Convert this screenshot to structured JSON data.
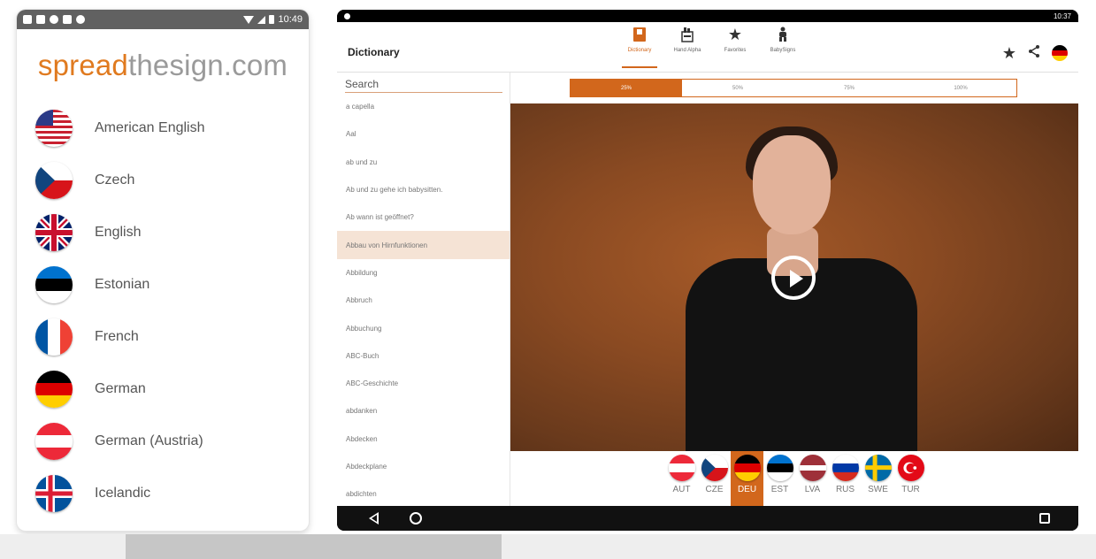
{
  "phone": {
    "status_time": "10:49",
    "logo_part1": "spread",
    "logo_part2": "thesign.com",
    "languages": [
      {
        "label": "American English",
        "flag": "usa"
      },
      {
        "label": "Czech",
        "flag": "cze"
      },
      {
        "label": "English",
        "flag": "gbr"
      },
      {
        "label": "Estonian",
        "flag": "est"
      },
      {
        "label": "French",
        "flag": "fra"
      },
      {
        "label": "German",
        "flag": "deu"
      },
      {
        "label": "German (Austria)",
        "flag": "aut"
      },
      {
        "label": "Icelandic",
        "flag": "isl"
      }
    ]
  },
  "tablet": {
    "status_time": "10:37",
    "title": "Dictionary",
    "nav": [
      {
        "label": "Dictionary",
        "icon": "book-icon",
        "active": true
      },
      {
        "label": "Hand Alpha",
        "icon": "hand-alphabet-icon",
        "active": false
      },
      {
        "label": "Favorites",
        "icon": "star-icon",
        "active": false
      },
      {
        "label": "BabySigns",
        "icon": "baby-icon",
        "active": false
      }
    ],
    "search_placeholder": "Search",
    "words": [
      "a capella",
      "Aal",
      "ab und zu",
      "Ab und zu gehe ich babysitten.",
      "Ab wann ist geöffnet?",
      "Abbau von Hirnfunktionen",
      "Abbildung",
      "Abbruch",
      "Abbuchung",
      "ABC-Buch",
      "ABC-Geschichte",
      "abdanken",
      "Abdecken",
      "Abdeckplane",
      "abdichten"
    ],
    "active_word_index": 5,
    "speed_options": [
      "25%",
      "50%",
      "75%",
      "100%"
    ],
    "active_speed_index": 0,
    "sign_languages": [
      {
        "code": "AUT",
        "flag": "aut"
      },
      {
        "code": "CZE",
        "flag": "cze"
      },
      {
        "code": "DEU",
        "flag": "deu"
      },
      {
        "code": "EST",
        "flag": "est"
      },
      {
        "code": "LVA",
        "flag": "lva"
      },
      {
        "code": "RUS",
        "flag": "rus"
      },
      {
        "code": "SWE",
        "flag": "swe"
      },
      {
        "code": "TUR",
        "flag": "tur"
      }
    ],
    "active_language_index": 2
  },
  "colors": {
    "accent": "#d2671c",
    "logo_orange": "#e07a1f"
  }
}
